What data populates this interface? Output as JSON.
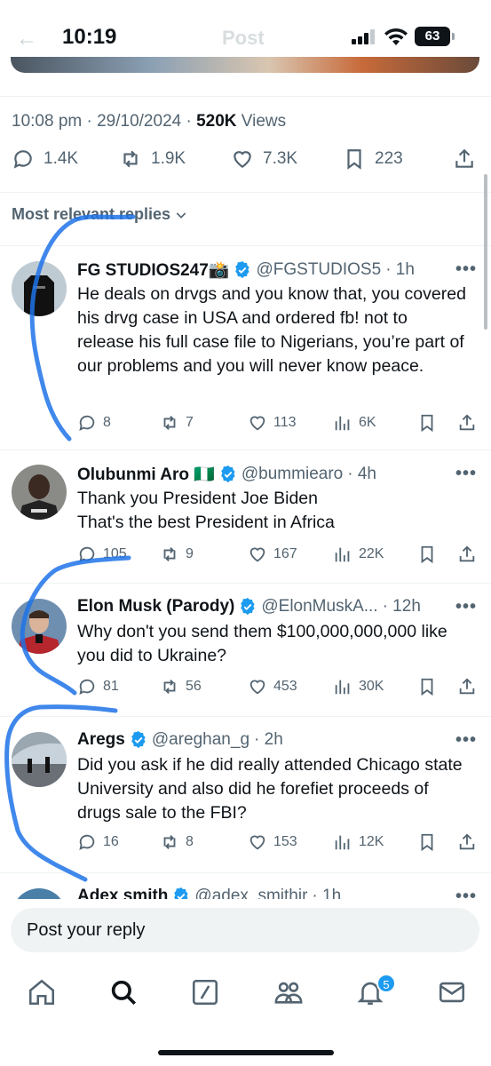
{
  "status_bar": {
    "time": "10:19",
    "battery": "63",
    "back_ghost": "←",
    "title_ghost": "Post"
  },
  "post": {
    "meta_time": "10:08 pm · 29/10/2024 · ",
    "views_count": "520K",
    "views_label": " Views",
    "replies": "1.4K",
    "reposts": "1.9K",
    "likes": "7.3K",
    "bookmarks": "223"
  },
  "sort_label": "Most relevant replies",
  "replies": [
    {
      "name": "FG STUDIOS247📸",
      "handle": "@FGSTUDIOS5",
      "time": "· 1h",
      "text": "He deals on drvgs and you know that, you covered his drvg case in USA and ordered fb! not to release his full case file to Nigerians, you’re part of our problems and you will never know peace.",
      "replies": "8",
      "reposts": "7",
      "likes": "113",
      "views": "6K"
    },
    {
      "name": "Olubunmi Aro 🇳🇬",
      "handle": "@bummiearo",
      "time": "· 4h",
      "text": "Thank you President Joe Biden\nThat's the best President in Africa",
      "replies": "105",
      "reposts": "9",
      "likes": "167",
      "views": "22K"
    },
    {
      "name": "Elon Musk (Parody)",
      "handle": "@ElonMuskA...",
      "time": "· 12h",
      "text": "Why don't you send them $100,000,000,000 like you did to Ukraine?",
      "replies": "81",
      "reposts": "56",
      "likes": "453",
      "views": "30K"
    },
    {
      "name": "Aregs",
      "handle": "@areghan_g",
      "time": "· 2h",
      "text": "Did you ask if he did really attended Chicago state University and also did he forefiet proceeds of drugs sale to the FBI?",
      "replies": "16",
      "reposts": "8",
      "likes": "153",
      "views": "12K"
    },
    {
      "name": "Adex smith",
      "handle": "@adex_smithjr",
      "time": "· 1h"
    }
  ],
  "composer": {
    "placeholder": "Post your reply"
  },
  "tabbar": {
    "notifications_badge": "5"
  },
  "icons": [
    "home-icon",
    "search-icon",
    "grok-icon",
    "communities-icon",
    "notifications-icon",
    "messages-icon",
    "verified-icon"
  ],
  "colors": {
    "accent": "#1d9bf0",
    "muted": "#536471",
    "scribble": "#1e73e8"
  }
}
